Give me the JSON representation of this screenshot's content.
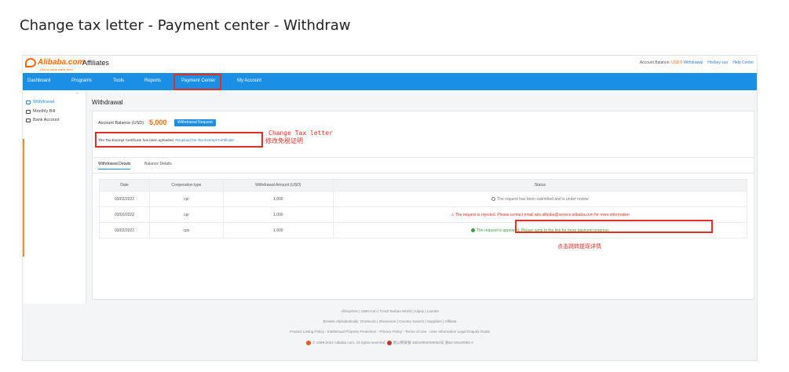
{
  "doc_title": "Change tax letter - Payment center - Withdraw",
  "header": {
    "logo_text": "Alibaba.com",
    "logo_tagline": "Global trade starts here.",
    "app_title": "Affiliates",
    "balance_label": "Account Balance:",
    "balance_value": "US$ 0",
    "withdrawal_link": "Withdrawal",
    "user": "Hockey sun",
    "help": "Help Center"
  },
  "nav": {
    "items": [
      "Dashboard",
      "Programs",
      "Tools",
      "Reports",
      "Payment Center",
      "My Account"
    ]
  },
  "sidebar": {
    "collapse_icon": "chevron-left-icon",
    "items": [
      {
        "label": "Withdrawal",
        "icon": "dollar-icon",
        "active": true
      },
      {
        "label": "Monthly Bill",
        "icon": "bill-icon",
        "active": false
      },
      {
        "label": "Bank Account",
        "icon": "bank-icon",
        "active": false
      }
    ]
  },
  "withdrawal": {
    "title": "Withdrawal",
    "balance_label": "Account Balance (USD)",
    "balance_value": "5,000",
    "request_button": "Withdrawal Request",
    "cert_text": "The Tax-Exempt Certificate has been uploaded.",
    "cert_link": "Reupload the Tax-Exempt Certificate",
    "annotation_en": "Change Tax letter",
    "annotation_cn": "修改免税证明"
  },
  "tabs": [
    "Withdrawal Details",
    "Balance Details"
  ],
  "table": {
    "headers": [
      "Date",
      "Cooperation type",
      "Withdrawal Amount (USD)",
      "Status"
    ],
    "rows": [
      {
        "date": "03/02/2022",
        "type": "cpi",
        "amount": "1,000",
        "status": "The request has been submitted and is under review",
        "status_kind": "review"
      },
      {
        "date": "03/02/2022",
        "type": "cpi",
        "amount": "1,000",
        "status": "The request is rejected. Please contact email ads.alibaba@service.alibaba.com for more information",
        "status_kind": "rejected"
      },
      {
        "date": "03/02/2022",
        "type": "cps",
        "amount": "1,000",
        "status": "The request is approved. Please jump to the link for more payment progress",
        "status_kind": "approved"
      }
    ]
  },
  "annotation_detail_cn": "点击跳转提现详情",
  "footer": {
    "line1": "AliExpress | 1688.com | Tmall Taobao World | Alipay | Lazada",
    "line2": "Browse Alphabetically: Onetouch | Showroom | Country Search | Suppliers | Affiliate",
    "line3": "Product Listing Policy - Intellectual Property Protection - Privacy Policy - Terms of Use - User Information Legal Enquiry Guide",
    "line4": "© 1999-2022 Alibaba.com. All rights reserved.",
    "line4b": "浙公网安备 33010002000092号",
    "line4c": "浙B2-20120091-4"
  },
  "colors": {
    "nav_blue": "#1a8fe3",
    "accent_orange": "#ff6a00",
    "highlight_red": "#e03024",
    "approved_green": "#3aa23a"
  }
}
